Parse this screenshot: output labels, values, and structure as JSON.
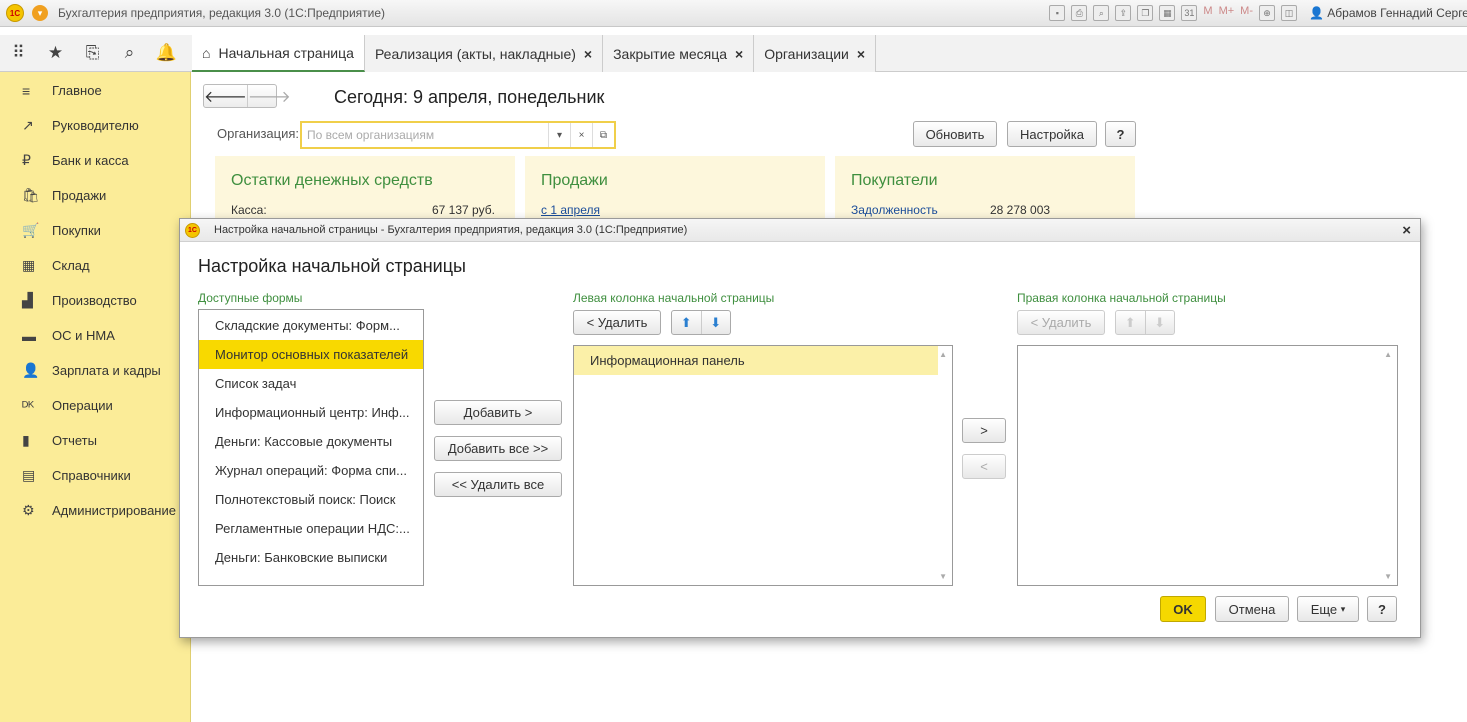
{
  "titlebar": {
    "logo": "1С",
    "title": "Бухгалтерия предприятия, редакция 3.0  (1С:Предприятие)",
    "m_labels": [
      "M",
      "M+",
      "M-"
    ],
    "user": "Абрамов Геннадий Сергеевич"
  },
  "nav": {
    "tabs": [
      {
        "label": "Начальная страница",
        "closable": false,
        "active": true
      },
      {
        "label": "Реализация (акты, накладные)",
        "closable": true
      },
      {
        "label": "Закрытие месяца",
        "closable": true
      },
      {
        "label": "Организации",
        "closable": true
      }
    ],
    "close_glyph": "×"
  },
  "sidebar": {
    "items": [
      {
        "label": "Главное",
        "icon": "≡"
      },
      {
        "label": "Руководителю",
        "icon": "↗"
      },
      {
        "label": "Банк и касса",
        "icon": "₽"
      },
      {
        "label": "Продажи",
        "icon": "🛍"
      },
      {
        "label": "Покупки",
        "icon": "🛒"
      },
      {
        "label": "Склад",
        "icon": "▦"
      },
      {
        "label": "Производство",
        "icon": "▟"
      },
      {
        "label": "ОС и НМА",
        "icon": "▬"
      },
      {
        "label": "Зарплата и кадры",
        "icon": "👤"
      },
      {
        "label": "Операции",
        "icon": "ᴰᴷ"
      },
      {
        "label": "Отчеты",
        "icon": "▮"
      },
      {
        "label": "Справочники",
        "icon": "▤"
      },
      {
        "label": "Администрирование",
        "icon": "⚙"
      }
    ]
  },
  "main": {
    "title": "Сегодня: 9 апреля, понедельник",
    "org_label": "Организация:",
    "org_placeholder": "По всем организациям",
    "refresh": "Обновить",
    "settings": "Настройка",
    "help": "?",
    "panels": [
      {
        "heading": "Остатки денежных средств",
        "row_label": "Касса:",
        "row_value": "67 137 руб."
      },
      {
        "heading": "Продажи",
        "row_label": "с 1 апреля",
        "row_value": ""
      },
      {
        "heading": "Покупатели",
        "row_label": "Задолженность",
        "row_value": "28 278 003"
      }
    ]
  },
  "dialog": {
    "logo": "1С",
    "title": "Настройка начальной страницы - Бухгалтерия предприятия, редакция 3.0  (1С:Предприятие)",
    "close": "×",
    "heading": "Настройка начальной страницы",
    "available_label": "Доступные формы",
    "available": [
      "Складские документы: Форм...",
      "Монитор основных показателей",
      "Список задач",
      "Информационный центр: Инф...",
      "Деньги: Кассовые документы",
      "Журнал операций: Форма спи...",
      "Полнотекстовый поиск: Поиск",
      "Регламентные операции НДС:...",
      "Деньги: Банковские выписки"
    ],
    "available_selected": 1,
    "add": "Добавить >",
    "add_all": "Добавить все >>",
    "remove_all": "<< Удалить все",
    "left_label": "Левая колонка начальной страницы",
    "left_remove": "< Удалить",
    "left_items": [
      "Информационная панель"
    ],
    "move_right": ">",
    "move_left": "<",
    "right_label": "Правая колонка начальной страницы",
    "right_remove": "< Удалить",
    "right_items": [],
    "ok": "OK",
    "cancel": "Отмена",
    "more": "Еще",
    "help": "?"
  }
}
